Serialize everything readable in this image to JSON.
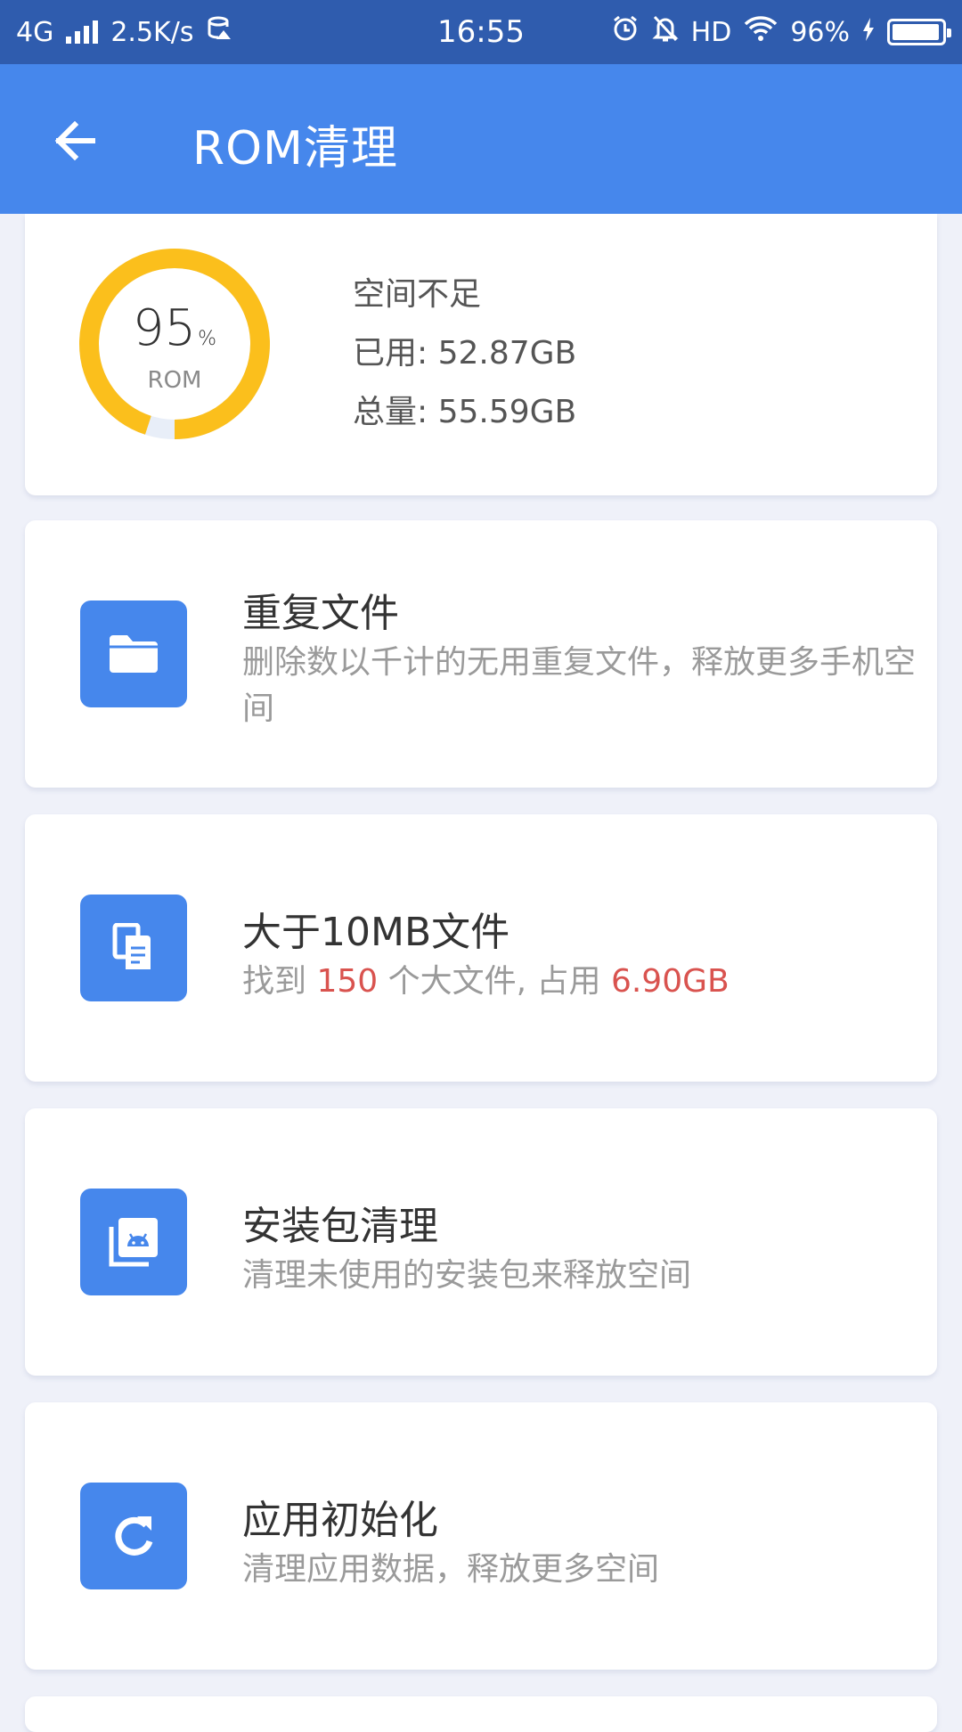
{
  "status_bar": {
    "network": "4G",
    "speed": "2.5K/s",
    "time": "16:55",
    "hd": "HD",
    "battery_percent": "96%",
    "battery_level": 0.96
  },
  "header": {
    "title": "ROM清理"
  },
  "storage": {
    "percent": "95",
    "percent_sign": "%",
    "label": "ROM",
    "usage_fraction": 0.95,
    "status": "空间不足",
    "used": "已用: 52.87GB",
    "total": "总量: 55.59GB",
    "ring_color": "#fbbf1c",
    "track_color": "#e8eef8"
  },
  "features": [
    {
      "title": "重复文件",
      "desc": "删除数以千计的无用重复文件，释放更多手机空间",
      "icon": "folder-icon"
    },
    {
      "title": "大于10MB文件",
      "desc_prefix": "找到 ",
      "count": "150",
      "desc_mid": " 个大文件, 占用 ",
      "size": "6.90GB",
      "icon": "copy-files-icon"
    },
    {
      "title": "安装包清理",
      "desc": "清理未使用的安装包来释放空间",
      "icon": "android-package-icon"
    },
    {
      "title": "应用初始化",
      "desc": "清理应用数据，释放更多空间",
      "icon": "refresh-icon"
    }
  ],
  "colors": {
    "status_bar": "#2f5cae",
    "header": "#4687ec",
    "accent": "#4687ec",
    "highlight": "#d9534f",
    "background": "#eff1f9"
  }
}
